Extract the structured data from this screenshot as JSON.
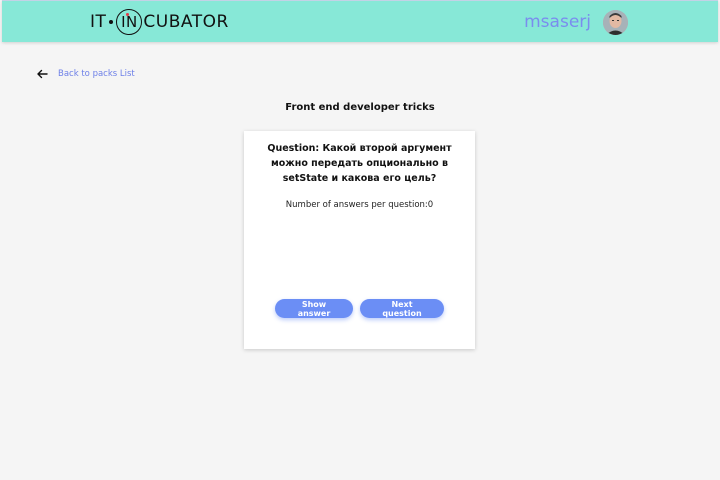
{
  "header": {
    "logo": {
      "part1": "IT",
      "circle": "IN",
      "part2": "CUBATOR"
    },
    "user_name": "msaserj",
    "accent_color": "#87e8d7"
  },
  "back_link": {
    "label": "Back to packs List",
    "icon": "arrow-left-icon"
  },
  "pack": {
    "title": "Front end developer tricks"
  },
  "card": {
    "question": "Question: Какой второй аргумент можно передать опционально в setState и какова его цель?",
    "answers_label": "Number of answers per question:0"
  },
  "buttons": {
    "show_answer": "Show answer",
    "next_question": "Next question",
    "color": "#6b8ef5"
  }
}
